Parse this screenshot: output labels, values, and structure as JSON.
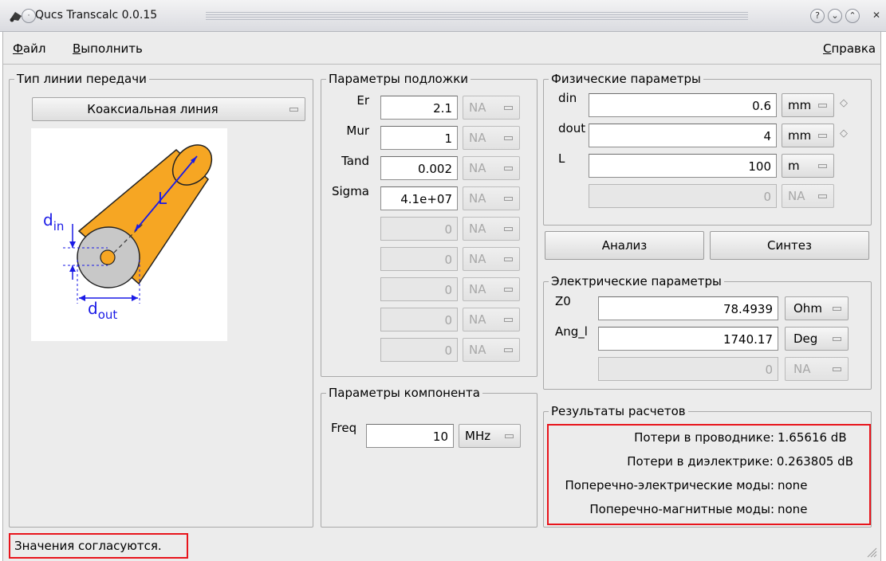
{
  "window": {
    "title": "Qucs Transcalc 0.0.15",
    "buttons": {
      "help": "?",
      "minimize": "⌄",
      "maximize": "⌃",
      "close": "✕"
    }
  },
  "menu": {
    "file": "Файл",
    "run": "Выполнить",
    "help": "Справка"
  },
  "line_type": {
    "title": "Тип линии передачи",
    "selected": "Коаксиальная линия",
    "diagram": {
      "din": "d",
      "din_sub": "in",
      "dout": "d",
      "dout_sub": "out",
      "length": "L"
    }
  },
  "substrate": {
    "title": "Параметры подложки",
    "rows": [
      {
        "label": "Er",
        "value": "2.1",
        "unit": "NA",
        "enabled": true
      },
      {
        "label": "Mur",
        "value": "1",
        "unit": "NA",
        "enabled": true
      },
      {
        "label": "Tand",
        "value": "0.002",
        "unit": "NA",
        "enabled": true
      },
      {
        "label": "Sigma",
        "value": "4.1e+07",
        "unit": "NA",
        "enabled": true
      },
      {
        "label": "",
        "value": "0",
        "unit": "NA",
        "enabled": false
      },
      {
        "label": "",
        "value": "0",
        "unit": "NA",
        "enabled": false
      },
      {
        "label": "",
        "value": "0",
        "unit": "NA",
        "enabled": false
      },
      {
        "label": "",
        "value": "0",
        "unit": "NA",
        "enabled": false
      },
      {
        "label": "",
        "value": "0",
        "unit": "NA",
        "enabled": false
      }
    ]
  },
  "component": {
    "title": "Параметры компонента",
    "label": "Freq",
    "value": "10",
    "unit": "MHz"
  },
  "physical": {
    "title": "Физические параметры",
    "rows": [
      {
        "label": "din",
        "value": "0.6",
        "unit": "mm",
        "enabled": true,
        "spin": true
      },
      {
        "label": "dout",
        "value": "4",
        "unit": "mm",
        "enabled": true,
        "spin": true
      },
      {
        "label": "L",
        "value": "100",
        "unit": "m",
        "enabled": true,
        "spin": false
      },
      {
        "label": "",
        "value": "0",
        "unit": "NA",
        "enabled": false,
        "spin": false
      }
    ]
  },
  "actions": {
    "analyze": "Анализ",
    "synthesize": "Синтез"
  },
  "electrical": {
    "title": "Электрические параметры",
    "rows": [
      {
        "label": "Z0",
        "value": "78.4939",
        "unit": "Ohm",
        "enabled": true
      },
      {
        "label": "Ang_l",
        "value": "1740.17",
        "unit": "Deg",
        "enabled": true
      },
      {
        "label": "",
        "value": "0",
        "unit": "NA",
        "enabled": false
      }
    ]
  },
  "results": {
    "title": "Результаты расчетов",
    "rows": [
      {
        "label": "Потери в проводнике:",
        "value": "1.65616 dB"
      },
      {
        "label": "Потери в диэлектрике:",
        "value": "0.263805 dB"
      },
      {
        "label": "Поперечно-электрические моды:",
        "value": "none"
      },
      {
        "label": "Поперечно-магнитные моды:",
        "value": "none"
      }
    ]
  },
  "status": "Значения согласуются.",
  "colors": {
    "highlight": "#e8141b",
    "cylinder": "#f6a623",
    "dimension": "#1a1ae6"
  }
}
